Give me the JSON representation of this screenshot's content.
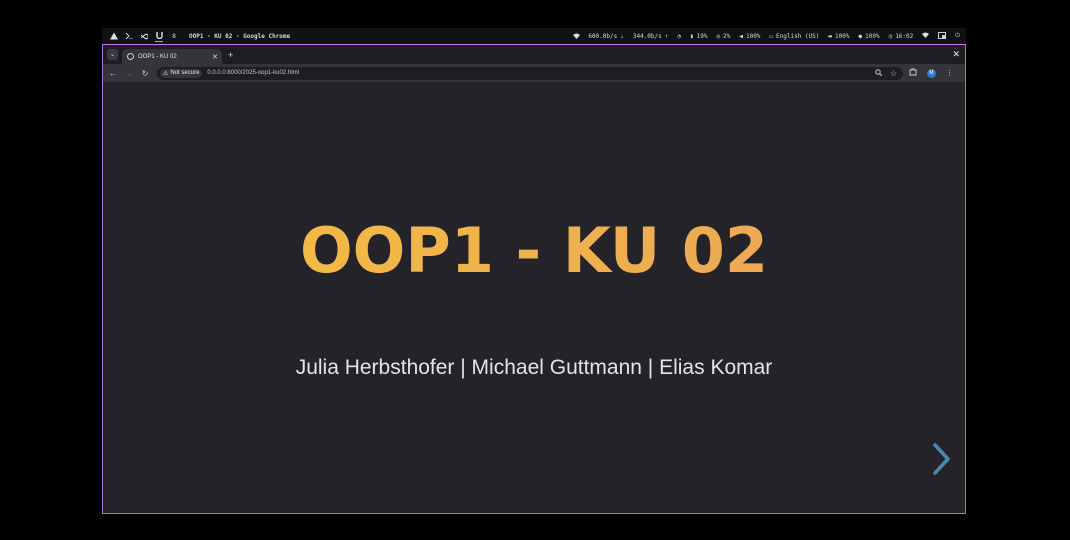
{
  "system_bar": {
    "workspaces": [
      "",
      "",
      "",
      "8"
    ],
    "window_title": "OOP1 - KU 02 - Google Chrome",
    "net_down": "600.0b/s",
    "net_up": "344.0b/s",
    "cpu": "19%",
    "mem": "2%",
    "volume": "100%",
    "keyboard_layout": "English (US)",
    "battery": "100%",
    "brightness": "100%",
    "clock": "16:02"
  },
  "browser": {
    "tab_title": "OOP1 - KU 02",
    "security_label": "Not secure",
    "url": "0.0.0.0:8000/2025-oop1-ku02.html",
    "profile_initial": "M"
  },
  "slide": {
    "title": "OOP1 - KU 02",
    "authors": "Julia Herbsthofer | Michael Guttmann | Elias Komar"
  },
  "colors": {
    "title_gradient_start": "#f5c040",
    "title_gradient_end": "#eaa35a",
    "arrow": "#4a88b0",
    "window_border": "#b36adf"
  },
  "icons": {
    "next": "chevron-right-icon"
  }
}
